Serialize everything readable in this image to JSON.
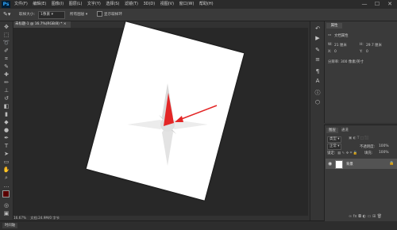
{
  "app": {
    "logo_text": "Ps"
  },
  "menu": [
    "文件(F)",
    "编辑(E)",
    "图像(I)",
    "图层(L)",
    "文字(Y)",
    "选择(S)",
    "滤镜(T)",
    "3D(D)",
    "视图(V)",
    "窗口(W)",
    "帮助(H)"
  ],
  "window_controls": {
    "minimize": "—",
    "maximize": "☐",
    "close": "✕"
  },
  "options_bar": {
    "sample_size_label": "取样大小:",
    "sample_size_value": "1像素",
    "sample_layers_label": "所有图层",
    "show_ring_label": "显示取样环",
    "eyedropper_icon": "eyedropper-icon"
  },
  "document_tab": {
    "title": "未标题-1 @ 16.7%(RGB/8) *",
    "close": "×"
  },
  "status_bar": {
    "zoom": "16.67%",
    "doc_info": "文档:24.9M/0 字节"
  },
  "timeline": {
    "label": "时间轴"
  },
  "properties": {
    "tab_label": "属性",
    "doc_label": "文档属性",
    "width_label": "W:",
    "width_value": "21 厘米",
    "height_label": "H:",
    "height_value": "29.7 厘米",
    "x_label": "X:",
    "x_value": "0",
    "y_label": "Y:",
    "y_value": "0",
    "resolution": "分辨率: 300 像素/英寸"
  },
  "layers": {
    "tab_layers": "图层",
    "tab_channels": "通道",
    "kind_label": "类型",
    "mode_label": "正常",
    "opacity_label": "不透明度:",
    "opacity_value": "100%",
    "lock_label": "锁定:",
    "fill_label": "填充:",
    "fill_value": "100%",
    "background_layer_name": "背景"
  },
  "colors": {
    "accent_red": "#e32626",
    "canvas_bg": "#282828",
    "panel_bg": "#3a3a3a"
  }
}
